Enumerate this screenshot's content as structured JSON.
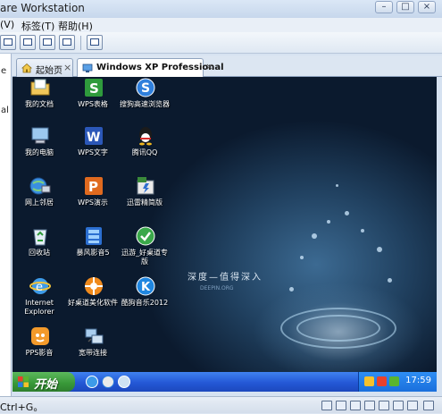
{
  "window": {
    "title": "are Workstation"
  },
  "menubar": {
    "items": [
      "(V)",
      "标签(T)",
      "帮助(H)"
    ]
  },
  "sidebar": {
    "visible_text": [
      "e",
      "al"
    ]
  },
  "tabs": [
    {
      "label": "起始页",
      "icon": "home-icon"
    },
    {
      "label": "Windows XP Professional",
      "icon": "vm-icon",
      "active": true
    }
  ],
  "desktop": {
    "brand_text": "深度—值得深入",
    "brand_sub": "DEEPIN.ORG",
    "icons": [
      {
        "label": "我的文档",
        "icon": "my-documents-icon"
      },
      {
        "label": "WPS表格",
        "icon": "wps-spreadsheet-icon"
      },
      {
        "label": "搜狗高速浏览器",
        "icon": "sogou-browser-icon"
      },
      {
        "label": "我的电脑",
        "icon": "my-computer-icon"
      },
      {
        "label": "WPS文字",
        "icon": "wps-writer-icon"
      },
      {
        "label": "腾讯QQ",
        "icon": "qq-icon"
      },
      {
        "label": "网上邻居",
        "icon": "network-icon"
      },
      {
        "label": "WPS演示",
        "icon": "wps-presentation-icon"
      },
      {
        "label": "迅雷精简版",
        "icon": "thunder-icon"
      },
      {
        "label": "回收站",
        "icon": "recycle-bin-icon"
      },
      {
        "label": "暴风影音5",
        "icon": "baofeng-icon"
      },
      {
        "label": "迅游_好桌道专版",
        "icon": "xunyou-icon"
      },
      {
        "label": "Internet Explorer",
        "icon": "ie-icon"
      },
      {
        "label": "好桌道美化软件",
        "icon": "haozhuodao-icon"
      },
      {
        "label": "酷狗音乐2012",
        "icon": "kugou-icon"
      },
      {
        "label": "PPS影音",
        "icon": "pps-icon"
      },
      {
        "label": "宽带连接",
        "icon": "broadband-icon"
      }
    ]
  },
  "taskbar": {
    "start_label": "开始",
    "clock": "17:59"
  },
  "statusbar": {
    "text": "Ctrl+G。"
  },
  "colors": {
    "accent": "#2458d6",
    "start_green": "#3a9a3a",
    "desktop_dark": "#0b1a2e"
  }
}
